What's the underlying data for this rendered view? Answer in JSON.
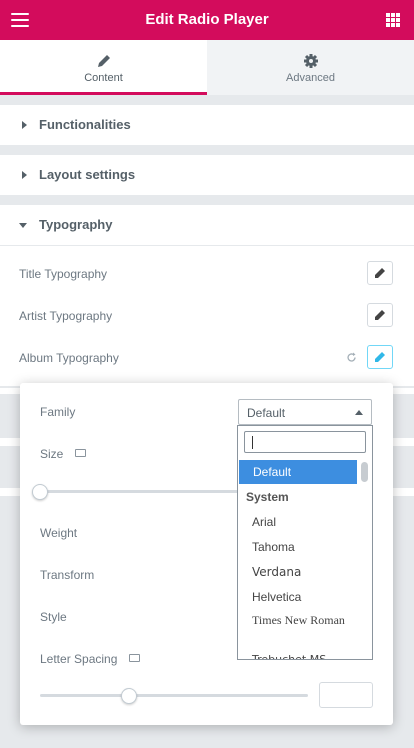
{
  "header": {
    "title": "Edit Radio Player",
    "menu_icon": "hamburger-menu-icon",
    "apps_icon": "apps-grid-icon",
    "color": "#d30c5c"
  },
  "tabs": [
    {
      "label": "Content",
      "icon": "pencil-icon",
      "active": true
    },
    {
      "label": "Advanced",
      "icon": "gear-icon",
      "active": false
    }
  ],
  "sections": [
    {
      "label": "Functionalities",
      "expanded": false
    },
    {
      "label": "Layout settings",
      "expanded": false
    },
    {
      "label": "Typography",
      "expanded": true
    }
  ],
  "typography": {
    "rows": [
      {
        "label": "Title Typography"
      },
      {
        "label": "Artist Typography"
      },
      {
        "label": "Album Typography"
      }
    ]
  },
  "popup": {
    "family_label": "Family",
    "family_value": "Default",
    "size_label": "Size",
    "weight_label": "Weight",
    "transform_label": "Transform",
    "style_label": "Style",
    "letter_spacing_label": "Letter Spacing",
    "letter_spacing_value": ""
  },
  "dropdown": {
    "search_value": "",
    "options": [
      {
        "label": "Default",
        "selected": true,
        "group": false
      },
      {
        "label": "System",
        "selected": false,
        "group": true
      },
      {
        "label": "Arial",
        "selected": false,
        "group": false
      },
      {
        "label": "Tahoma",
        "selected": false,
        "group": false
      },
      {
        "label": "Verdana",
        "selected": false,
        "group": false
      },
      {
        "label": "Helvetica",
        "selected": false,
        "group": false
      },
      {
        "label": "Times New Roman",
        "selected": false,
        "group": false
      },
      {
        "label": "Trebuchet MS",
        "selected": false,
        "group": false
      }
    ]
  }
}
